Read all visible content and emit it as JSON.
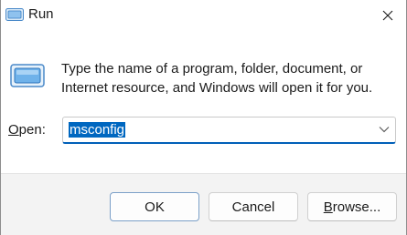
{
  "window": {
    "title": "Run",
    "close_icon": "close-icon"
  },
  "content": {
    "description": "Type the name of a program, folder, document, or Internet resource, and Windows will open it for you.",
    "open_label_prefix": "O",
    "open_label_rest": "pen:",
    "open_value": "msconfig"
  },
  "buttons": {
    "ok": "OK",
    "cancel": "Cancel",
    "browse_prefix": "B",
    "browse_rest": "rowse..."
  },
  "colors": {
    "accent": "#005fb8",
    "selection": "#0067c0",
    "footer_bg": "#f3f3f3"
  }
}
